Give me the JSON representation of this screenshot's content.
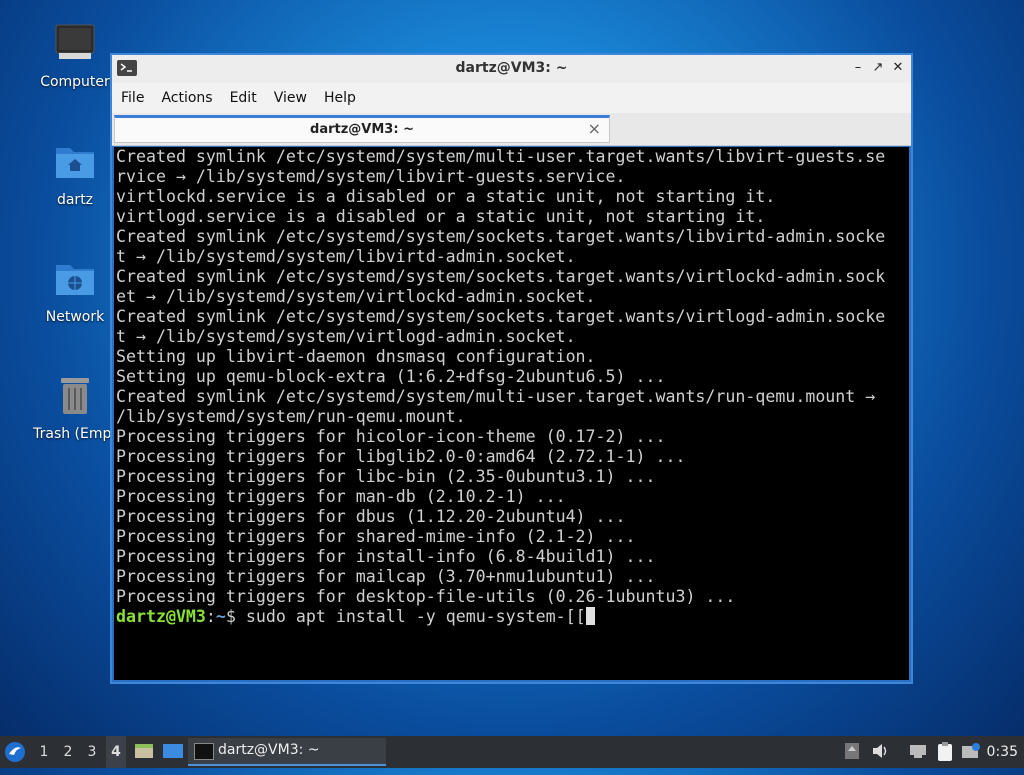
{
  "desktop": {
    "icons": [
      {
        "label": "Computer"
      },
      {
        "label": "dartz"
      },
      {
        "label": "Network"
      },
      {
        "label": "Trash (Empt"
      }
    ]
  },
  "window": {
    "title": "dartz@VM3: ~",
    "menu": [
      "File",
      "Actions",
      "Edit",
      "View",
      "Help"
    ],
    "tab_label": "dartz@VM3: ~",
    "terminal": {
      "lines": [
        "Created symlink /etc/systemd/system/multi-user.target.wants/libvirt-guests.se",
        "rvice → /lib/systemd/system/libvirt-guests.service.",
        "virtlockd.service is a disabled or a static unit, not starting it.",
        "virtlogd.service is a disabled or a static unit, not starting it.",
        "Created symlink /etc/systemd/system/sockets.target.wants/libvirtd-admin.socke",
        "t → /lib/systemd/system/libvirtd-admin.socket.",
        "Created symlink /etc/systemd/system/sockets.target.wants/virtlockd-admin.sock",
        "et → /lib/systemd/system/virtlockd-admin.socket.",
        "Created symlink /etc/systemd/system/sockets.target.wants/virtlogd-admin.socke",
        "t → /lib/systemd/system/virtlogd-admin.socket.",
        "Setting up libvirt-daemon dnsmasq configuration.",
        "Setting up qemu-block-extra (1:6.2+dfsg-2ubuntu6.5) ...",
        "Created symlink /etc/systemd/system/multi-user.target.wants/run-qemu.mount →",
        "/lib/systemd/system/run-qemu.mount.",
        "Processing triggers for hicolor-icon-theme (0.17-2) ...",
        "Processing triggers for libglib2.0-0:amd64 (2.72.1-1) ...",
        "Processing triggers for libc-bin (2.35-0ubuntu3.1) ...",
        "Processing triggers for man-db (2.10.2-1) ...",
        "Processing triggers for dbus (1.12.20-2ubuntu4) ...",
        "Processing triggers for shared-mime-info (2.1-2) ...",
        "Processing triggers for install-info (6.8-4build1) ...",
        "Processing triggers for mailcap (3.70+nmu1ubuntu1) ...",
        "Processing triggers for desktop-file-utils (0.26-1ubuntu3) ..."
      ],
      "prompt_user": "dartz@VM3",
      "prompt_sep": ":",
      "prompt_path": "~",
      "prompt_symbol": "$",
      "command": " sudo apt install -y qemu-system-[["
    }
  },
  "taskbar": {
    "workspaces": [
      "1",
      "2",
      "3",
      "4"
    ],
    "active_workspace": "4",
    "task_label": "dartz@VM3: ~",
    "clock": "0:35"
  },
  "colors": {
    "prompt_user": "#8ae234",
    "prompt_path": "#6a9fd8",
    "accent": "#3b7dd8"
  }
}
